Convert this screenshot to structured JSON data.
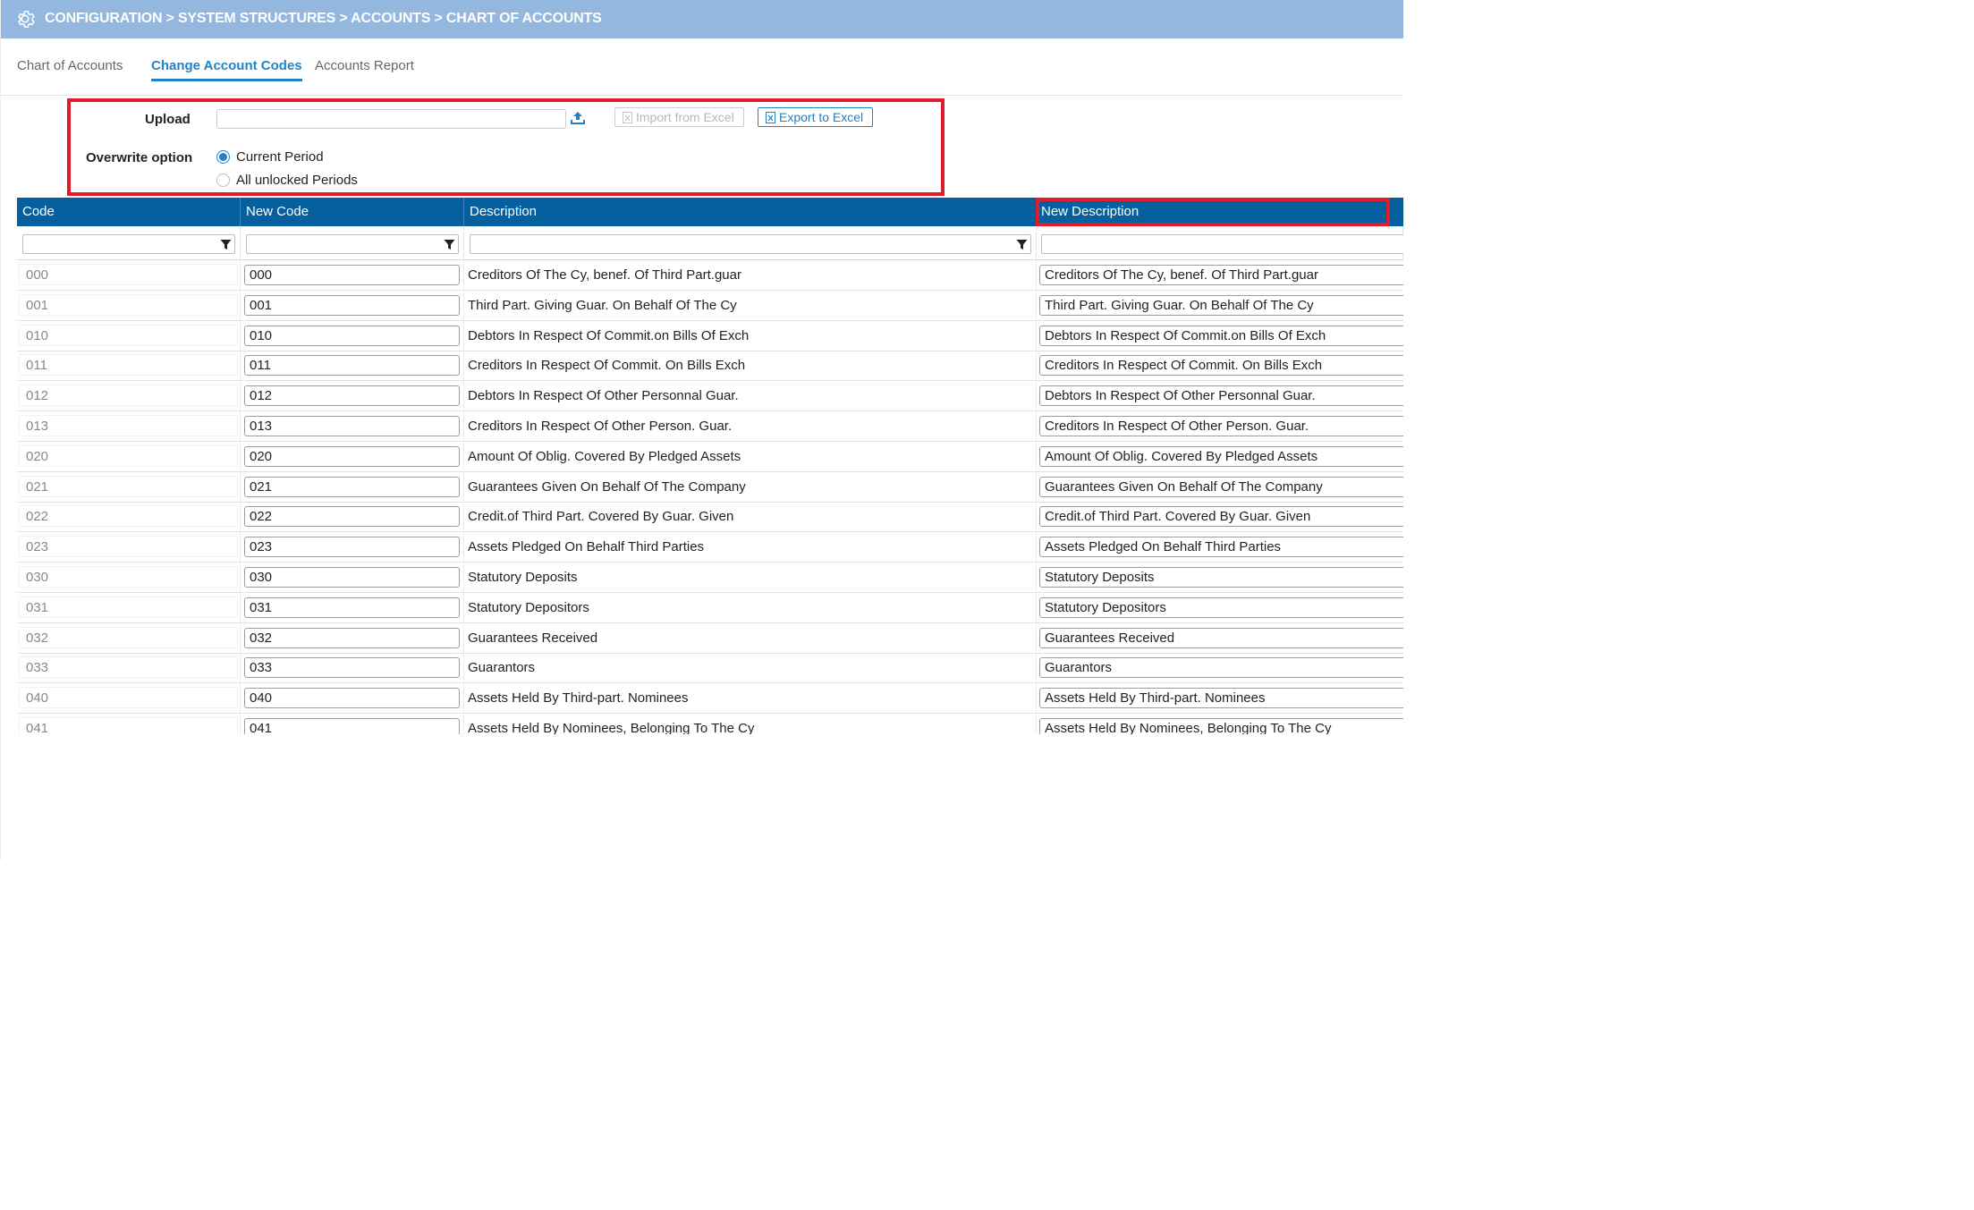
{
  "header": {
    "breadcrumb": "CONFIGURATION > SYSTEM STRUCTURES > ACCOUNTS > CHART OF ACCOUNTS",
    "icon": "gear-icon"
  },
  "tabs": [
    {
      "label": "Chart of Accounts",
      "active": false
    },
    {
      "label": "Change Account Codes",
      "active": true
    },
    {
      "label": "Accounts Report",
      "active": false
    }
  ],
  "upload": {
    "label": "Upload",
    "file_value": "",
    "import_label": "Import from Excel",
    "export_label": "Export to Excel",
    "overwrite_label": "Overwrite option",
    "options": [
      {
        "label": "Current Period",
        "selected": true
      },
      {
        "label": "All unlocked Periods",
        "selected": false
      }
    ]
  },
  "grid": {
    "columns": [
      "Code",
      "New Code",
      "Description",
      "New Description"
    ],
    "rows": [
      {
        "code": "000",
        "new_code": "000",
        "description": "Creditors Of The Cy, benef. Of Third Part.guar",
        "new_description": "Creditors Of The Cy, benef. Of Third Part.guar"
      },
      {
        "code": "001",
        "new_code": "001",
        "description": "Third Part. Giving Guar. On Behalf Of The Cy",
        "new_description": "Third Part. Giving Guar. On Behalf Of The Cy"
      },
      {
        "code": "010",
        "new_code": "010",
        "description": "Debtors In Respect Of Commit.on Bills Of Exch",
        "new_description": "Debtors In Respect Of Commit.on Bills Of Exch"
      },
      {
        "code": "011",
        "new_code": "011",
        "description": "Creditors In Respect Of Commit. On Bills Exch",
        "new_description": "Creditors In Respect Of Commit. On Bills Exch"
      },
      {
        "code": "012",
        "new_code": "012",
        "description": "Debtors In Respect Of Other Personnal Guar.",
        "new_description": "Debtors In Respect Of Other Personnal Guar."
      },
      {
        "code": "013",
        "new_code": "013",
        "description": "Creditors In Respect Of Other Person. Guar.",
        "new_description": "Creditors In Respect Of Other Person. Guar."
      },
      {
        "code": "020",
        "new_code": "020",
        "description": "Amount Of Oblig. Covered By Pledged Assets",
        "new_description": "Amount Of Oblig. Covered By Pledged Assets"
      },
      {
        "code": "021",
        "new_code": "021",
        "description": "Guarantees Given On Behalf Of The Company",
        "new_description": "Guarantees Given On Behalf Of The Company"
      },
      {
        "code": "022",
        "new_code": "022",
        "description": "Credit.of Third Part. Covered By Guar. Given",
        "new_description": "Credit.of Third Part. Covered By Guar. Given"
      },
      {
        "code": "023",
        "new_code": "023",
        "description": "Assets Pledged On Behalf Third Parties",
        "new_description": "Assets Pledged On Behalf Third Parties"
      },
      {
        "code": "030",
        "new_code": "030",
        "description": "Statutory Deposits",
        "new_description": "Statutory Deposits"
      },
      {
        "code": "031",
        "new_code": "031",
        "description": "Statutory Depositors",
        "new_description": "Statutory Depositors"
      },
      {
        "code": "032",
        "new_code": "032",
        "description": "Guarantees Received",
        "new_description": "Guarantees Received"
      },
      {
        "code": "033",
        "new_code": "033",
        "description": "Guarantors",
        "new_description": "Guarantors"
      },
      {
        "code": "040",
        "new_code": "040",
        "description": "Assets Held By Third-part. Nominees",
        "new_description": "Assets Held By Third-part. Nominees"
      },
      {
        "code": "041",
        "new_code": "041",
        "description": "Assets Held By Nominees, Belonging To The Cy",
        "new_description": "Assets Held By Nominees, Belonging To The Cy"
      }
    ]
  },
  "colors": {
    "header_bg": "#93b7df",
    "grid_header_bg": "#04609f",
    "accent": "#1f84c7",
    "highlight_border": "#e01b2c"
  }
}
